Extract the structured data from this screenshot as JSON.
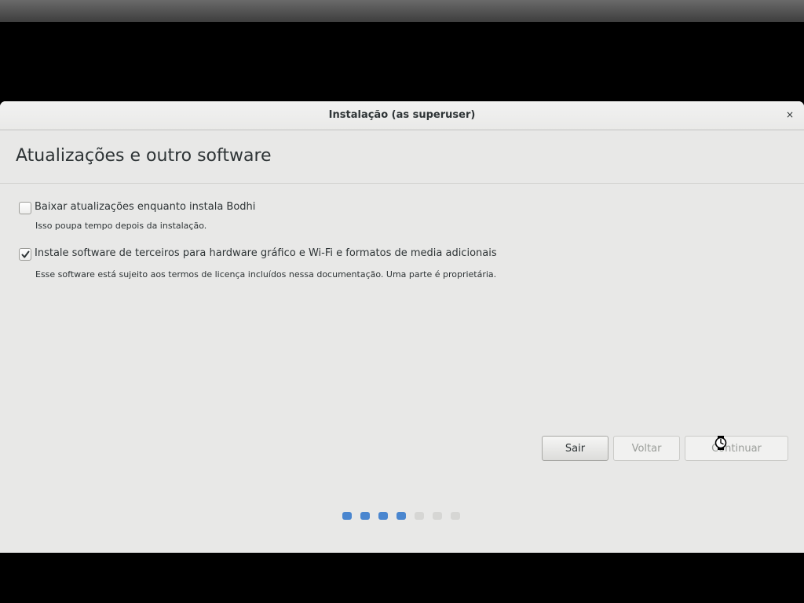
{
  "window": {
    "title": "Instalação (as superuser)",
    "close_glyph": "×"
  },
  "page": {
    "title": "Atualizações e outro software"
  },
  "options": [
    {
      "label": "Baixar atualizações enquanto instala Bodhi",
      "description": "Isso poupa tempo depois da instalação.",
      "checked": false
    },
    {
      "label": "Instale software de terceiros para hardware gráfico e Wi-Fi e formatos de media adicionais",
      "description": "Esse software está sujeito aos termos de licença incluídos nessa documentação. Uma parte é proprietária.",
      "checked": true
    }
  ],
  "buttons": {
    "quit": "Sair",
    "back": "Voltar",
    "continue": "Continuar"
  },
  "progress": {
    "total_steps": 7,
    "completed_steps": 4,
    "active_color": "#4a86cf",
    "inactive_color": "#d6d6d4"
  },
  "icons": {
    "close": "close-icon",
    "check": "checkmark-icon",
    "cursor": "busy-cursor-icon"
  }
}
